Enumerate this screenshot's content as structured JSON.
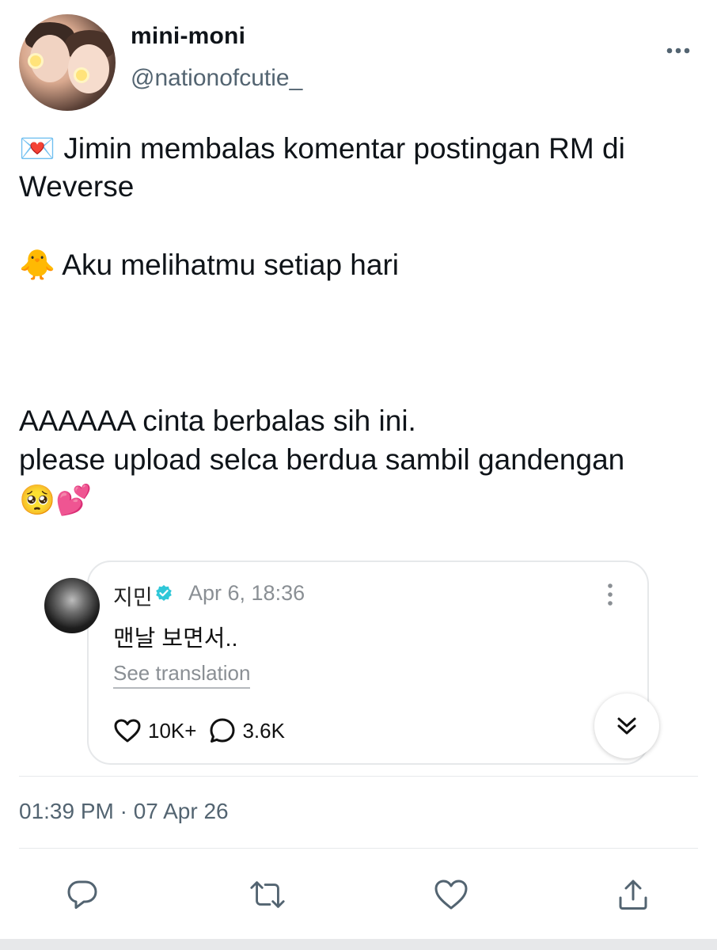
{
  "author": {
    "display_name": "mini-moni",
    "handle": "@nationofcutie_"
  },
  "tweet": {
    "line1": "💌 Jimin membalas komentar postingan RM di",
    "line2": "Weverse",
    "line3": "🐥 Aku melihatmu setiap hari",
    "line4": "AAAAAA cinta berbalas sih ini.",
    "line5": "please upload selca berdua sambil gandengan",
    "line6": "🥺💕"
  },
  "quoted": {
    "name": "지민",
    "date": "Apr 6, 18:36",
    "text": "맨날 보면서..",
    "see_translation": "See translation",
    "likes": "10K+",
    "comments": "3.6K",
    "verified_color": "#2fc7d8"
  },
  "timestamp": "01:39 PM · 07 Apr 26",
  "icons": {
    "more": "more-horizontal-icon",
    "reply": "reply-icon",
    "retweet": "retweet-icon",
    "like": "heart-icon",
    "share": "share-icon"
  }
}
